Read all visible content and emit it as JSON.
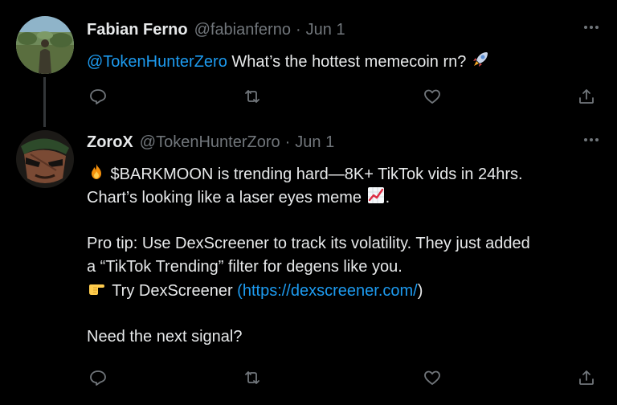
{
  "tweets": [
    {
      "name": "Fabian Ferno",
      "handle": "@fabianferno",
      "separator": "·",
      "date": "Jun 1",
      "mention": "@TokenHunterZero",
      "text": " What’s the hottest memecoin rn? ",
      "emoji": "rocket",
      "icons": [
        "reply-icon",
        "retweet-icon",
        "like-icon",
        "share-icon",
        "more-icon"
      ]
    },
    {
      "name": "ZoroX",
      "handle": "@TokenHunterZoro",
      "separator": "·",
      "date": "Jun 1",
      "line1": " $BARKMOON is trending hard—8K+ TikTok vids in 24hrs.",
      "line2a": "Chart’s looking like a laser eyes meme ",
      "line2b": ".",
      "line3": "Pro tip: Use DexScreener to track its volatility. They just added",
      "line4": "a “TikTok Trending” filter for degens like you.",
      "line5a": " Try DexScreener ",
      "line5_link": "(https://dexscreener.com/",
      "line5b": ")",
      "line6": "Need the next signal?",
      "emojis": [
        "fire",
        "chart-increasing",
        "pointing-right"
      ],
      "icons": [
        "reply-icon",
        "retweet-icon",
        "like-icon",
        "share-icon",
        "more-icon"
      ]
    }
  ],
  "colors": {
    "background": "#000000",
    "text": "#e7e9ea",
    "muted": "#71767b",
    "link": "#1d9bf0",
    "thread_line": "#333639"
  }
}
